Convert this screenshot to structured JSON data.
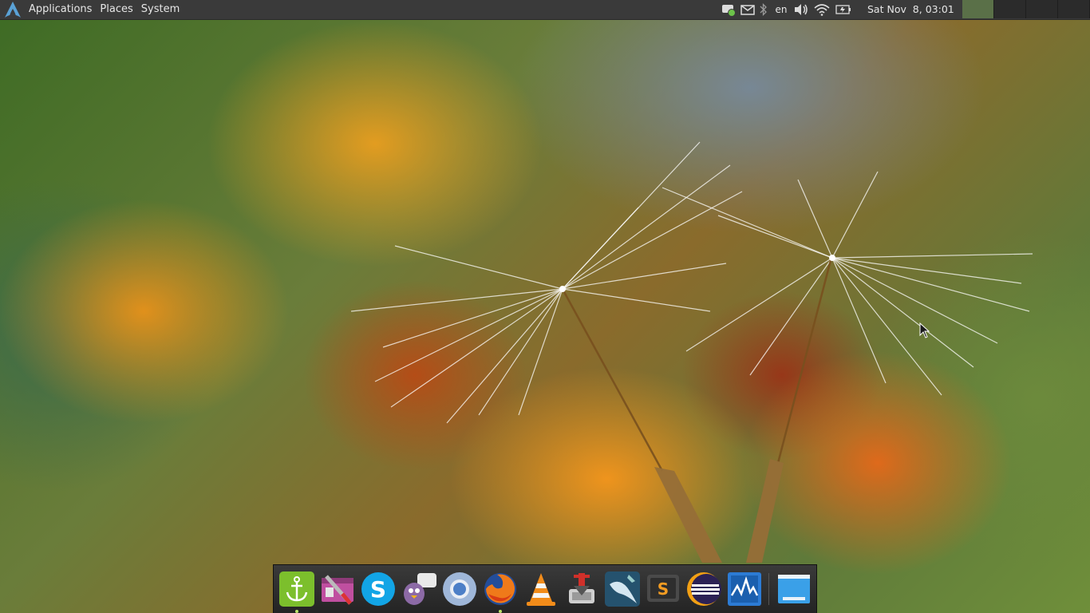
{
  "top_panel": {
    "menus": [
      "Applications",
      "Places",
      "System"
    ],
    "keyboard_layout": "en",
    "clock": "Sat Nov  8, 03:01",
    "workspaces": [
      {
        "active": true
      },
      {
        "active": false
      },
      {
        "active": false
      },
      {
        "active": false
      }
    ],
    "tray_icons": [
      "chat-status-icon",
      "mail-icon",
      "bluetooth-icon",
      "volume-icon",
      "wifi-icon",
      "battery-icon"
    ]
  },
  "dock": {
    "items": [
      {
        "icon": "anchor-icon",
        "running": true
      },
      {
        "icon": "system-tools-icon",
        "running": false
      },
      {
        "icon": "skype-icon",
        "running": false
      },
      {
        "icon": "pidgin-icon",
        "running": false
      },
      {
        "icon": "chromium-icon",
        "running": false
      },
      {
        "icon": "firefox-icon",
        "running": true
      },
      {
        "icon": "vlc-icon",
        "running": false
      },
      {
        "icon": "transmission-icon",
        "running": false
      },
      {
        "icon": "mysql-workbench-icon",
        "running": false
      },
      {
        "icon": "sublime-text-icon",
        "running": false
      },
      {
        "icon": "eclipse-icon",
        "running": false
      },
      {
        "icon": "system-monitor-icon",
        "running": false
      },
      {
        "icon": "show-desktop-icon",
        "running": false
      }
    ]
  },
  "colors": {
    "panel_bg": "#3a3a3a",
    "active_workspace": "#5a7048",
    "running_dot": "#b9e26a"
  }
}
